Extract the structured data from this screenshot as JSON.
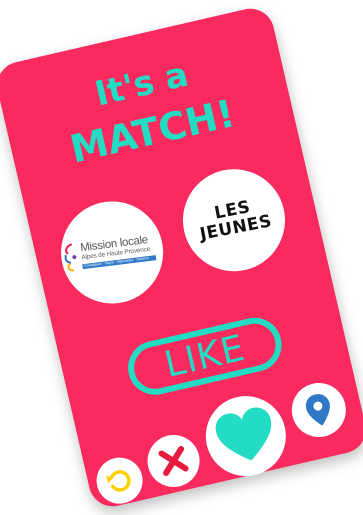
{
  "headline": {
    "line1": "It's a",
    "line2": "MATCH!"
  },
  "profiles": {
    "left": {
      "title": "Mission locale",
      "subtitle": "Alpes de Haute Provence",
      "bar_text": "Forcalquier · Digne · Manosque · Sisteron",
      "icon": "mission-locale-logo"
    },
    "right": {
      "line1": "LES",
      "line2": "JEUNES"
    }
  },
  "like_stamp": {
    "label": "LIKE"
  },
  "actions": [
    {
      "name": "undo",
      "icon": "undo-arrow-icon",
      "color": "#ffcf00"
    },
    {
      "name": "nope",
      "icon": "x-icon",
      "color": "#e8193e"
    },
    {
      "name": "like",
      "icon": "heart-icon",
      "color": "#22dcc3"
    },
    {
      "name": "location",
      "icon": "map-pin-icon",
      "color": "#2f78c8"
    }
  ],
  "colors": {
    "card": "#fb2a5e",
    "accent": "#22dcc3",
    "undo": "#ffcf00",
    "nope": "#e8193e",
    "pin": "#2f78c8"
  }
}
